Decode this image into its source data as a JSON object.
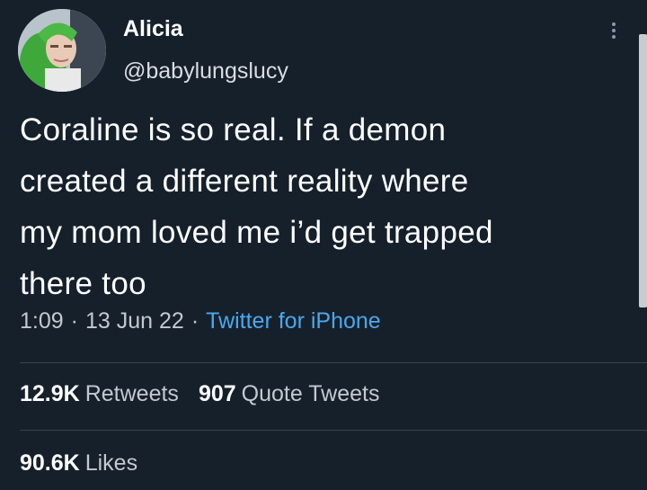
{
  "user": {
    "display_name": "Alicia",
    "handle": "@babylungslucy"
  },
  "tweet": {
    "text": "Coraline is so real. If a demon\ncreated a different reality where\nmy mom loved me i’d get trapped\nthere too",
    "time": "1:09",
    "date": "13 Jun 22",
    "separator": "·",
    "source": "Twitter for iPhone"
  },
  "stats": {
    "retweets_count": "12.9K",
    "retweets_label": "Retweets",
    "quotes_count": "907",
    "quotes_label": "Quote Tweets",
    "likes_count": "90.6K",
    "likes_label": "Likes"
  },
  "icons": {
    "more": "more-vertical-icon",
    "avatar": "profile-avatar"
  },
  "colors": {
    "background": "#15202b",
    "link": "#4aa8ec",
    "secondary_text": "#c3c9ce",
    "divider": "#38444d"
  }
}
